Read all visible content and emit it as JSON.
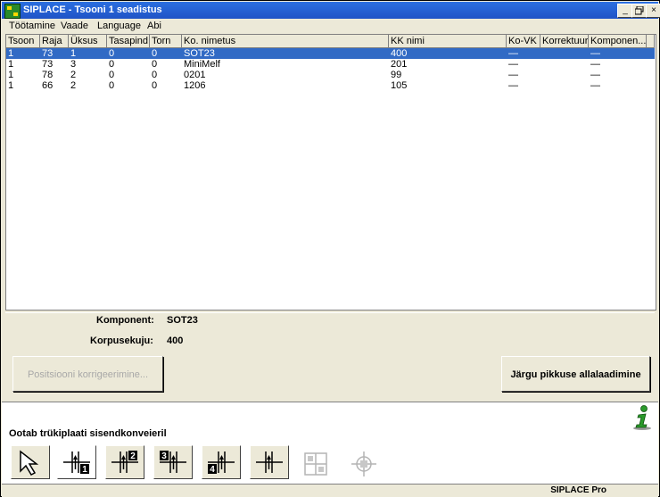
{
  "window": {
    "title": "SIPLACE - Tsooni 1 seadistus"
  },
  "menu": [
    {
      "label": "Töötamine"
    },
    {
      "label": "Vaade"
    },
    {
      "label": "Language"
    },
    {
      "label": "Abi"
    }
  ],
  "table": {
    "columns": [
      "Tsoon",
      "Raja",
      "Üksus",
      "Tasapind",
      "Torn",
      "Ko. nimetus",
      "KK nimi",
      "Ko-VK",
      "Korrektuur",
      "Komponen..."
    ],
    "rows": [
      {
        "cells": [
          "1",
          "73",
          "1",
          "0",
          "0",
          "SOT23",
          "400",
          "—",
          "",
          "—"
        ],
        "selected": true
      },
      {
        "cells": [
          "1",
          "73",
          "3",
          "0",
          "0",
          "MiniMelf",
          "201",
          "—",
          "",
          "—"
        ],
        "selected": false
      },
      {
        "cells": [
          "1",
          "78",
          "2",
          "0",
          "0",
          "0201",
          "99",
          "—",
          "",
          "—"
        ],
        "selected": false
      },
      {
        "cells": [
          "1",
          "66",
          "2",
          "0",
          "0",
          "1206",
          "105",
          "—",
          "",
          "—"
        ],
        "selected": false
      }
    ]
  },
  "details": {
    "component_label": "Komponent:",
    "component_value": "SOT23",
    "case_label": "Korpusekuju:",
    "case_value": "400"
  },
  "buttons": {
    "position_correction": "Positsiooni korrigeerimine...",
    "length_download": "Järgu pikkuse allalaadimine"
  },
  "status": {
    "message": "Ootab trükiplaati sisendkonveieril",
    "product": "SIPLACE Pro"
  },
  "toolbar": {
    "items": [
      {
        "icon": "pointer-arrow-icon",
        "enabled": true
      },
      {
        "icon": "conveyor-1-icon",
        "label": "1",
        "enabled": true,
        "active": true
      },
      {
        "icon": "conveyor-2-icon",
        "label": "2",
        "enabled": true
      },
      {
        "icon": "conveyor-3-icon",
        "label": "3",
        "enabled": true
      },
      {
        "icon": "conveyor-4-icon",
        "label": "4",
        "enabled": true
      },
      {
        "icon": "conveyor-center-icon",
        "enabled": true
      },
      {
        "icon": "grid-disabled-icon",
        "enabled": false
      },
      {
        "icon": "crosshair-disabled-icon",
        "enabled": false
      }
    ]
  },
  "colors": {
    "title_bar": "#1f53c6",
    "selection": "#316ac5",
    "window_bg": "#ece9d8",
    "info_icon": "#2a9a2a"
  }
}
